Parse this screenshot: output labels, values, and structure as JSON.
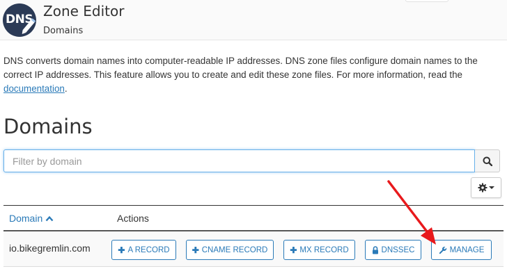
{
  "header": {
    "logo_text": "DNS",
    "title": "Zone Editor",
    "breadcrumb": "Domains"
  },
  "intro": {
    "text": "DNS converts domain names into computer-readable IP addresses. DNS zone files configure domain names to the correct IP addresses. This feature allows you to create and edit these zone files. For more information, read the ",
    "link_text": "documentation",
    "trailing": "."
  },
  "section_title": "Domains",
  "filter": {
    "placeholder": "Filter by domain",
    "value": ""
  },
  "table": {
    "columns": [
      "Domain",
      "Actions"
    ],
    "sort_column": "Domain",
    "sort_direction": "ascending",
    "rows": [
      {
        "domain": "io.bikegremlin.com",
        "actions": [
          {
            "icon": "plus-icon",
            "label": "A RECORD"
          },
          {
            "icon": "plus-icon",
            "label": "CNAME RECORD"
          },
          {
            "icon": "plus-icon",
            "label": "MX RECORD"
          },
          {
            "icon": "lock-icon",
            "label": "DNSSEC"
          },
          {
            "icon": "wrench-icon",
            "label": "MANAGE"
          }
        ]
      }
    ]
  },
  "colors": {
    "link": "#2a7ab8",
    "annotation_arrow": "#e8191c",
    "logo_bg": "#2b3a56"
  }
}
